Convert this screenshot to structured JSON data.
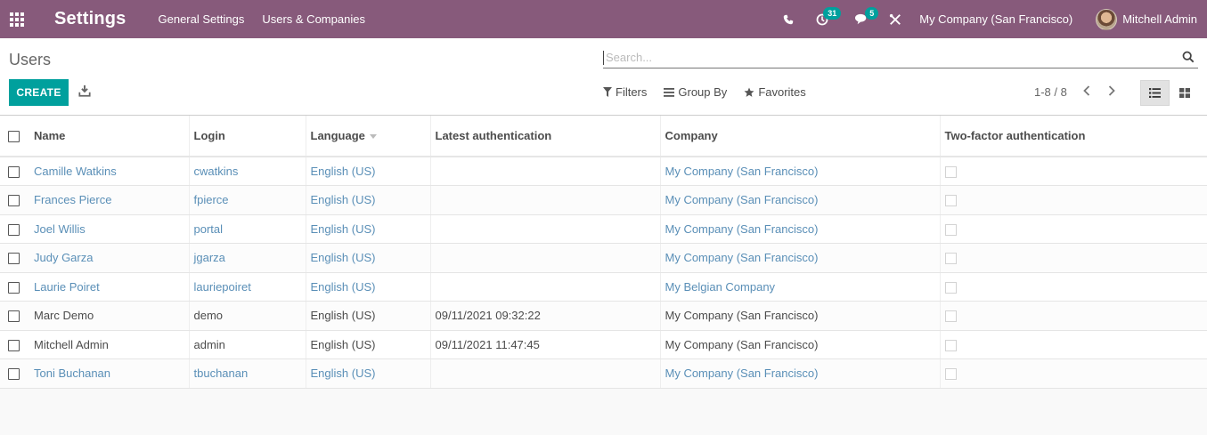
{
  "navbar": {
    "app_title": "Settings",
    "menu": [
      "General Settings",
      "Users & Companies"
    ],
    "activity_badge": "31",
    "message_badge": "5",
    "company": "My Company (San Francisco)",
    "user": "Mitchell Admin"
  },
  "control_panel": {
    "breadcrumb": "Users",
    "create_label": "CREATE",
    "search_placeholder": "Search...",
    "filters_label": "Filters",
    "group_by_label": "Group By",
    "favorites_label": "Favorites",
    "pager": "1-8 / 8"
  },
  "table": {
    "columns": [
      "Name",
      "Login",
      "Language",
      "Latest authentication",
      "Company",
      "Two-factor authentication"
    ],
    "rows": [
      {
        "name": "Camille Watkins",
        "login": "cwatkins",
        "language": "English (US)",
        "latest_auth": "",
        "company": "My Company (San Francisco)",
        "link": true
      },
      {
        "name": "Frances Pierce",
        "login": "fpierce",
        "language": "English (US)",
        "latest_auth": "",
        "company": "My Company (San Francisco)",
        "link": true
      },
      {
        "name": "Joel Willis",
        "login": "portal",
        "language": "English (US)",
        "latest_auth": "",
        "company": "My Company (San Francisco)",
        "link": true
      },
      {
        "name": "Judy Garza",
        "login": "jgarza",
        "language": "English (US)",
        "latest_auth": "",
        "company": "My Company (San Francisco)",
        "link": true
      },
      {
        "name": "Laurie Poiret",
        "login": "lauriepoiret",
        "language": "English (US)",
        "latest_auth": "",
        "company": "My Belgian Company",
        "link": true
      },
      {
        "name": "Marc Demo",
        "login": "demo",
        "language": "English (US)",
        "latest_auth": "09/11/2021 09:32:22",
        "company": "My Company (San Francisco)",
        "link": false
      },
      {
        "name": "Mitchell Admin",
        "login": "admin",
        "language": "English (US)",
        "latest_auth": "09/11/2021 11:47:45",
        "company": "My Company (San Francisco)",
        "link": false
      },
      {
        "name": "Toni Buchanan",
        "login": "tbuchanan",
        "language": "English (US)",
        "latest_auth": "",
        "company": "My Company (San Francisco)",
        "link": true
      }
    ]
  },
  "colors": {
    "navbar": "#875a7b",
    "primary_button": "#00a09d",
    "link": "#5a8fb7"
  },
  "icons": [
    "apps-grid-icon",
    "phone-icon",
    "activity-clock-icon",
    "chat-icon",
    "debug-tools-icon",
    "download-icon",
    "search-icon",
    "filter-icon",
    "group-by-icon",
    "star-icon",
    "chevron-left-icon",
    "chevron-right-icon",
    "list-view-icon",
    "kanban-view-icon"
  ]
}
